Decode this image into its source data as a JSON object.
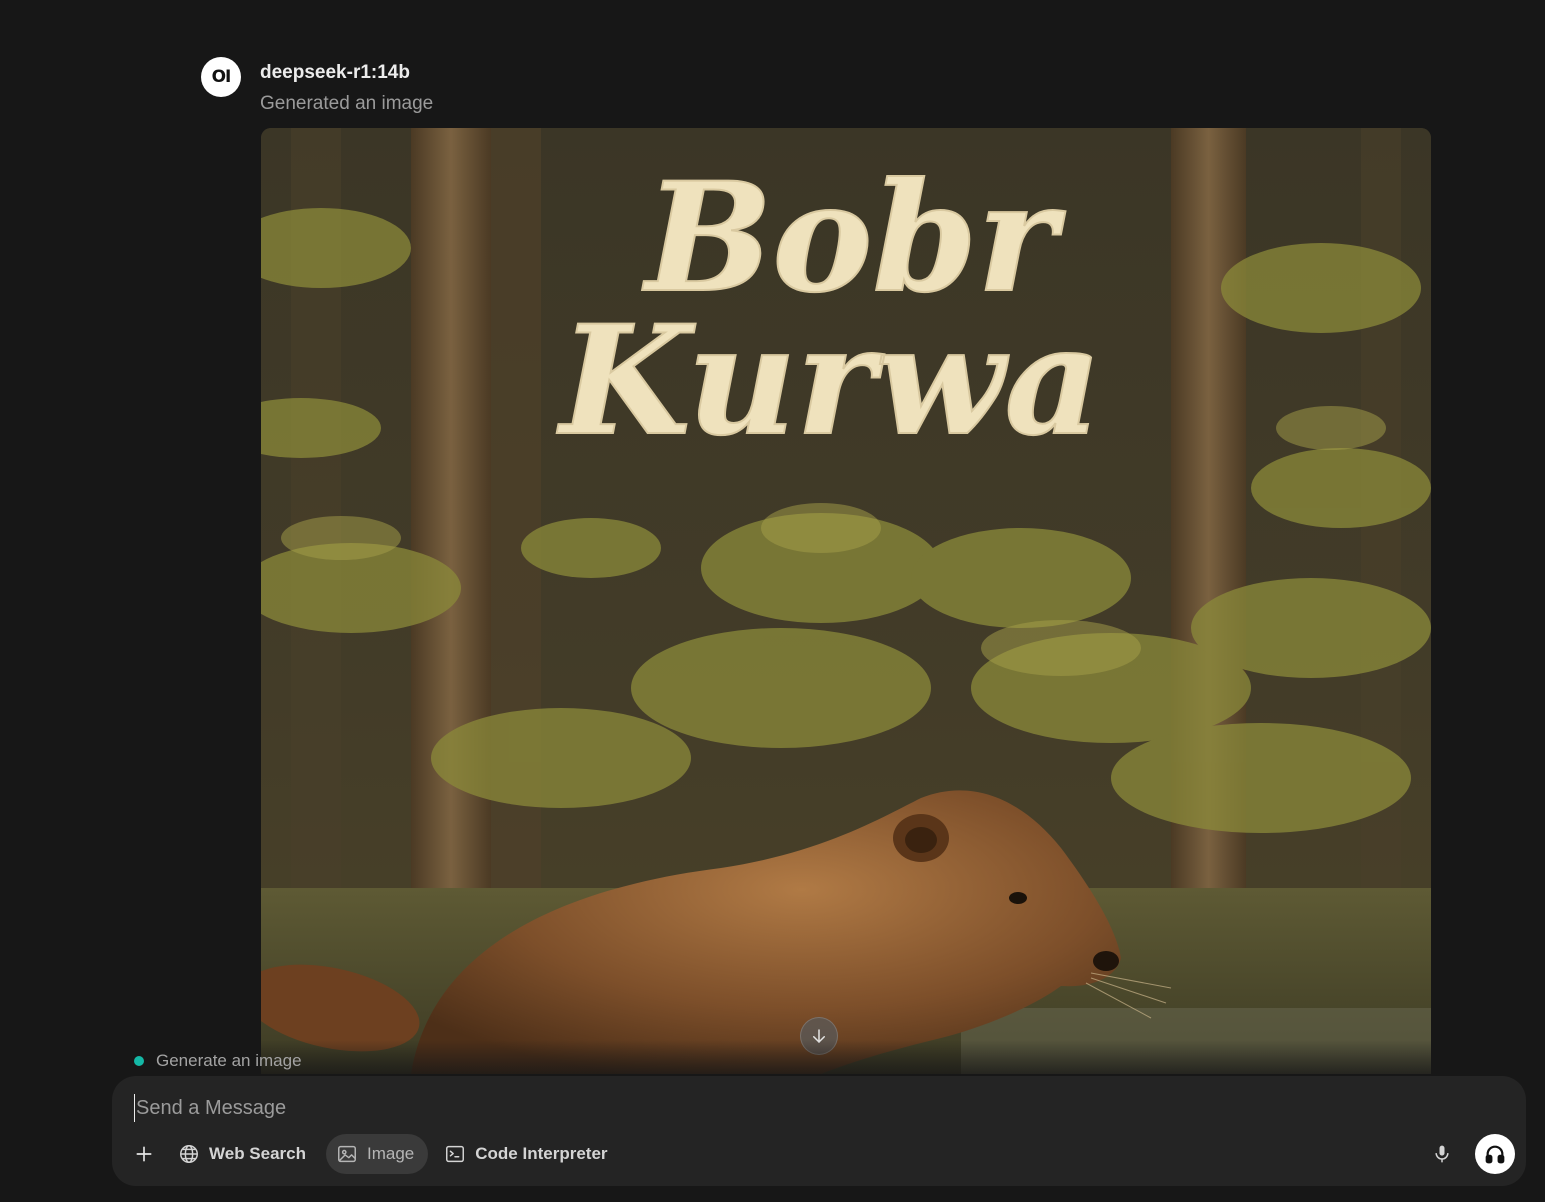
{
  "message": {
    "avatar_text": "OI",
    "model_name": "deepseek-r1:14b",
    "status": "Generated an image",
    "image": {
      "title_line1": "Bobr",
      "title_line2": "Kurwa",
      "colors": {
        "forest_dark": "#3a3322",
        "foliage": "#8e8a3c",
        "title": "#efe2bd",
        "beaver": "#7a4a26"
      }
    }
  },
  "suggestion": {
    "text": "Generate an image",
    "dot_color": "#14b8a6"
  },
  "composer": {
    "placeholder": "Send a Message",
    "value": "",
    "tools": [
      {
        "label": "Web Search",
        "icon": "globe-icon"
      },
      {
        "label": "Image",
        "icon": "image-icon",
        "active": true
      },
      {
        "label": "Code Interpreter",
        "icon": "terminal-icon"
      }
    ]
  }
}
